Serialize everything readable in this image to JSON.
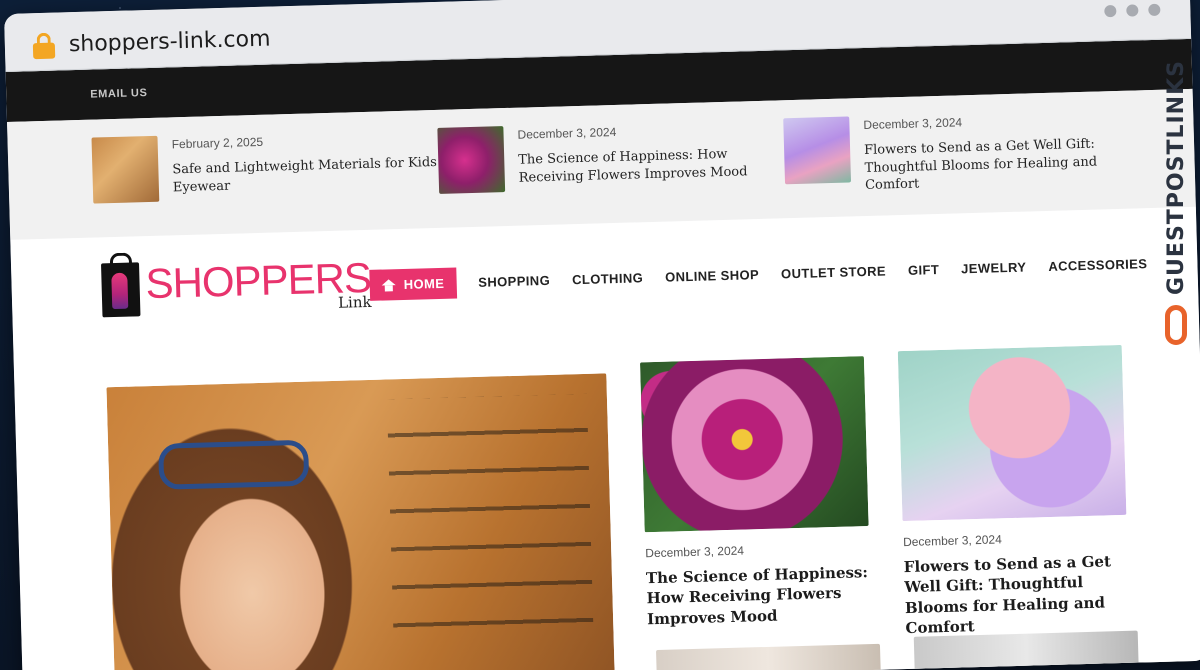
{
  "browser": {
    "url": "shoppers-link.com"
  },
  "topbar": {
    "email_label": "EMAIL US"
  },
  "ticker": [
    {
      "date": "February 2, 2025",
      "title": "Safe and Lightweight Materials for Kids Eyewear",
      "thumb": "kids"
    },
    {
      "date": "December 3, 2024",
      "title": "The Science of Happiness: How Receiving Flowers Improves Mood",
      "thumb": "flower"
    },
    {
      "date": "December 3, 2024",
      "title": "Flowers to Send as a Get Well Gift: Thoughtful Blooms for Healing and Comfort",
      "thumb": "bouquet"
    }
  ],
  "logo": {
    "main": "SHOPPERS",
    "sub": "Link"
  },
  "nav": {
    "items": [
      "HOME",
      "SHOPPING",
      "CLOTHING",
      "ONLINE SHOP",
      "OUTLET STORE",
      "GIFT",
      "JEWELRY",
      "ACCESSORIES"
    ]
  },
  "cards": [
    {
      "date": "December 3, 2024",
      "title": "The Science of Happiness: How Receiving Flowers Improves Mood"
    },
    {
      "date": "December 3, 2024",
      "title": "Flowers to Send as a Get Well Gift: Thoughtful Blooms for Healing and Comfort"
    }
  ],
  "watermark": {
    "text": "GUESTPOSTLINKS"
  },
  "colors": {
    "accent": "#e8336d",
    "topbar": "#161616",
    "watermark_icon": "#e8632b"
  },
  "icons": {
    "lock": "lock-icon",
    "home": "home-icon",
    "window_controls": "window-dots-icon"
  }
}
